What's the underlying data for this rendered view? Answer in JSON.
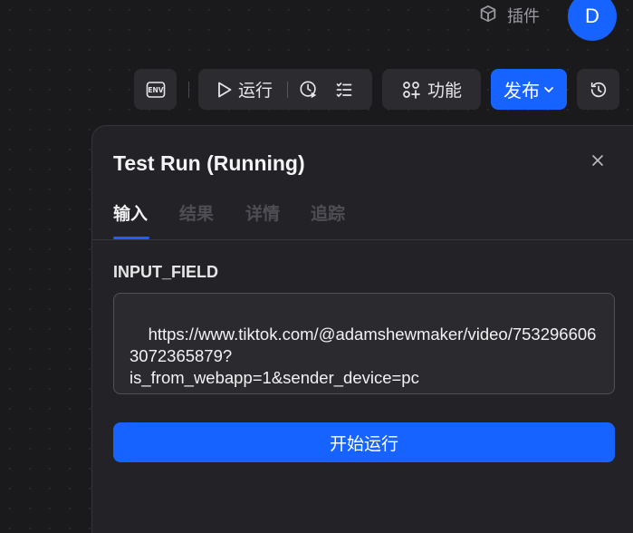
{
  "header": {
    "plugins_label": "插件",
    "avatar_letter": "D"
  },
  "toolbar": {
    "env_label": "ENV",
    "run_label": "运行",
    "function_label": "功能",
    "publish_label": "发布"
  },
  "panel": {
    "title": "Test Run (Running)",
    "tabs": [
      {
        "label": "输入",
        "active": true
      },
      {
        "label": "结果",
        "active": false
      },
      {
        "label": "详情",
        "active": false
      },
      {
        "label": "追踪",
        "active": false
      }
    ],
    "field_label": "INPUT_FIELD",
    "field_value": "https://www.tiktok.com/@adamshewmaker/video/7532966063072365879?\nis_from_webapp=1&sender_device=pc",
    "start_button": "开始运行"
  },
  "colors": {
    "accent": "#1763ff",
    "background": "#1a1a1d",
    "panel": "#232327"
  }
}
